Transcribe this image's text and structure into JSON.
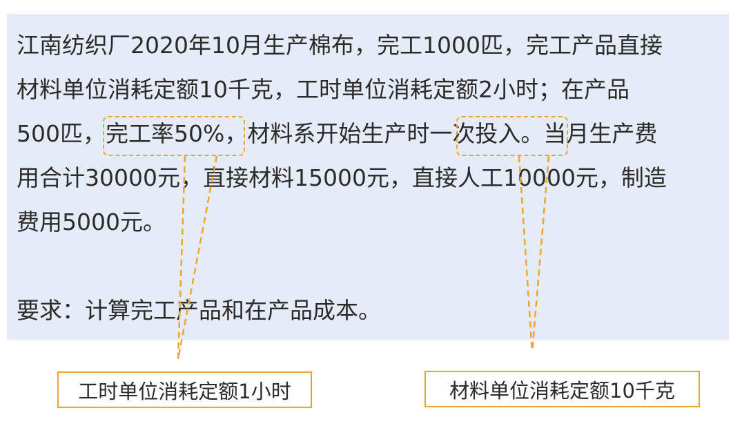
{
  "problem": {
    "line1": "江南纺织厂2020年10月生产棉布，完工1000匹，完工产品直接",
    "line2": "材料单位消耗定额10千克，工时单位消耗定额2小时；在产品",
    "line3": "500匹，完工率50%，材料系开始生产时一次投入。当月生产费",
    "line4": "用合计30000元，直接材料15000元，直接人工10000元，制造",
    "line5": "费用5000元。",
    "requirement": "要求：计算完工产品和在产品成本。"
  },
  "annotations": {
    "left_callout": "工时单位消耗定额1小时",
    "right_callout": "材料单位消耗定额10千克"
  },
  "colors": {
    "panel_background": "#e6ecf7",
    "highlight_orange": "#eea42e",
    "text": "#2b2b2b"
  }
}
